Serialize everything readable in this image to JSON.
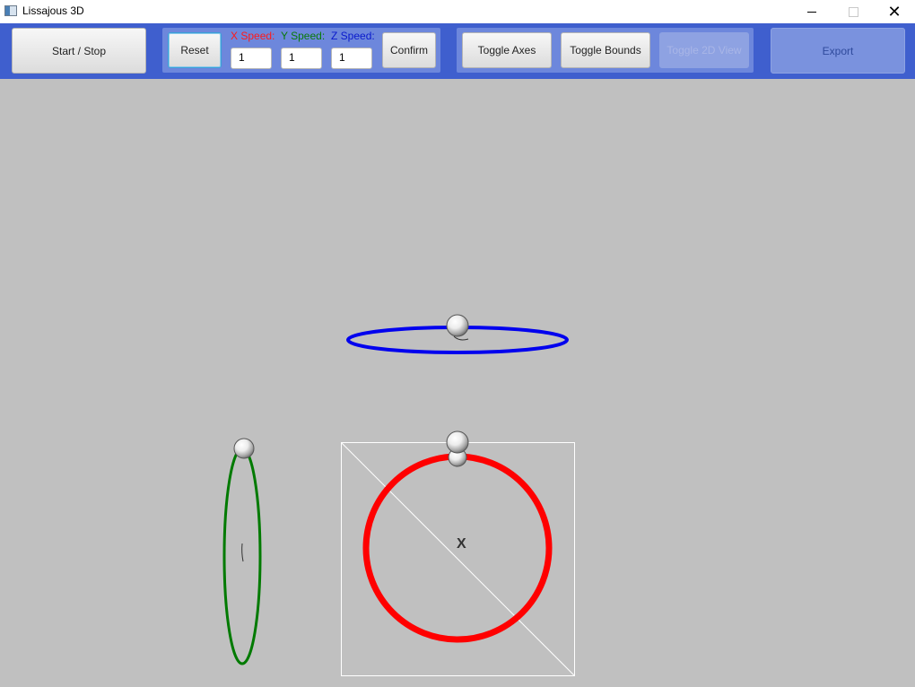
{
  "window": {
    "title": "Lissajous 3D"
  },
  "toolbar": {
    "start_stop": "Start / Stop",
    "reset": "Reset",
    "x_speed_label": "X Speed:",
    "y_speed_label": "Y Speed:",
    "z_speed_label": "Z Speed:",
    "x_speed_value": "1",
    "y_speed_value": "1",
    "z_speed_value": "1",
    "confirm": "Confirm",
    "toggle_axes": "Toggle Axes",
    "toggle_bounds": "Toggle Bounds",
    "toggle_2d": "Toggle 2D View",
    "export": "Export"
  },
  "scene": {
    "axis_label_x": "X"
  },
  "colors": {
    "x_axis": "#ff0000",
    "y_axis": "#008000",
    "z_axis": "#0000ff",
    "toolbar_bg": "#3f5fce",
    "canvas_bg": "#c0c0c0"
  }
}
